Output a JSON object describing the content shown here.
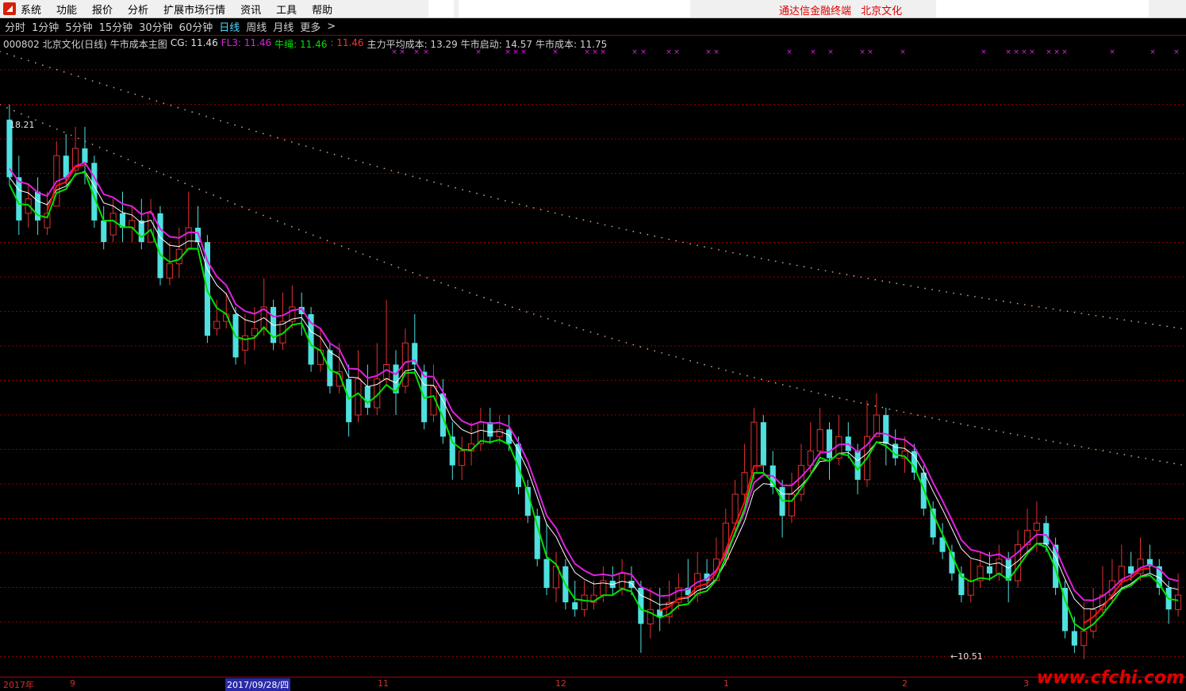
{
  "menu": {
    "items": [
      "系统",
      "功能",
      "报价",
      "分析",
      "扩展市场行情",
      "资讯",
      "工具",
      "帮助"
    ],
    "brand": "通达信金融终端",
    "stock_name": "北京文化"
  },
  "periods": {
    "items": [
      "分时",
      "1分钟",
      "5分钟",
      "15分钟",
      "30分钟",
      "60分钟",
      "日线",
      "周线",
      "月线",
      "更多"
    ],
    "active": "日线",
    "more_arrow": ">"
  },
  "info": {
    "code_title": "000802 北京文化(日线) 牛市成本主图",
    "cg": "CG: 11.46",
    "fl3": "FL3: 11.46",
    "niusheng": "牛绳: 11.46",
    "unnamed": ": 11.46",
    "main_cost": "主力平均成本: 13.29",
    "bull_start": "牛市启动: 14.57",
    "bull_cost": "牛市成本: 11.75"
  },
  "colors": {
    "up": "#e03030",
    "down": "#4fe0e0",
    "ma_magenta": "#e020e0",
    "ma_white": "#ffffff",
    "ma_green": "#00e000",
    "cost_red": "#ff1010",
    "grid": "#8a0000",
    "dots": "#c0a080",
    "cross": "#e020e0"
  },
  "annotations": {
    "high_label": "18.21",
    "low_label": "←10.51"
  },
  "axis": {
    "labels": [
      "2017年",
      "9",
      "2017/09/28/四",
      "11",
      "12",
      "1",
      "2",
      "3"
    ],
    "selected": "2017/09/28/四"
  },
  "watermark": "www.cfchi.com",
  "chart_data": {
    "type": "candlestick",
    "title": "000802 北京文化(日线) 牛市成本主图",
    "ylim": [
      10.3,
      19.0
    ],
    "high": 18.21,
    "low": 10.51,
    "candles_n": 125,
    "candles": [
      [
        18.0,
        17.2,
        18.21,
        17.1
      ],
      [
        17.2,
        16.6,
        17.5,
        16.4
      ],
      [
        16.7,
        16.9,
        17.1,
        16.5
      ],
      [
        17.0,
        16.6,
        17.2,
        16.4
      ],
      [
        16.5,
        16.7,
        17.0,
        16.4
      ],
      [
        16.8,
        17.5,
        17.7,
        16.8
      ],
      [
        17.5,
        17.2,
        17.8,
        17.1
      ],
      [
        17.3,
        17.6,
        17.9,
        17.2
      ],
      [
        17.6,
        17.4,
        17.9,
        17.1
      ],
      [
        17.4,
        16.6,
        17.5,
        16.5
      ],
      [
        16.6,
        16.3,
        16.8,
        16.2
      ],
      [
        16.4,
        16.7,
        16.9,
        16.3
      ],
      [
        16.7,
        16.5,
        17.0,
        16.3
      ],
      [
        16.5,
        16.6,
        16.8,
        16.3
      ],
      [
        16.6,
        16.3,
        16.9,
        16.2
      ],
      [
        16.3,
        16.7,
        16.9,
        16.3
      ],
      [
        16.7,
        15.8,
        16.8,
        15.7
      ],
      [
        15.8,
        16.0,
        16.3,
        15.7
      ],
      [
        16.0,
        16.2,
        16.5,
        15.8
      ],
      [
        16.2,
        16.5,
        17.0,
        16.2
      ],
      [
        16.5,
        16.3,
        16.8,
        16.2
      ],
      [
        16.3,
        15.0,
        16.4,
        14.9
      ],
      [
        15.1,
        15.2,
        15.5,
        15.0
      ],
      [
        15.2,
        15.3,
        15.6,
        15.1
      ],
      [
        15.3,
        14.7,
        15.4,
        14.6
      ],
      [
        14.8,
        15.0,
        15.3,
        14.6
      ],
      [
        15.0,
        15.1,
        15.4,
        14.8
      ],
      [
        15.1,
        15.4,
        15.8,
        15.0
      ],
      [
        15.4,
        14.9,
        15.5,
        14.8
      ],
      [
        14.9,
        15.2,
        15.6,
        14.8
      ],
      [
        15.2,
        15.4,
        15.7,
        15.1
      ],
      [
        15.4,
        15.3,
        15.6,
        15.0
      ],
      [
        15.3,
        14.6,
        15.4,
        14.5
      ],
      [
        14.6,
        14.8,
        15.1,
        14.5
      ],
      [
        14.8,
        14.3,
        14.9,
        14.2
      ],
      [
        14.3,
        14.5,
        14.9,
        14.2
      ],
      [
        14.4,
        13.8,
        14.6,
        13.6
      ],
      [
        13.9,
        14.4,
        14.8,
        13.8
      ],
      [
        14.3,
        14.0,
        14.6,
        13.9
      ],
      [
        14.0,
        14.4,
        14.9,
        13.9
      ],
      [
        14.4,
        14.6,
        15.5,
        14.3
      ],
      [
        14.6,
        14.2,
        14.8,
        13.9
      ],
      [
        14.3,
        14.9,
        15.1,
        14.2
      ],
      [
        14.9,
        14.6,
        15.3,
        14.5
      ],
      [
        14.5,
        13.8,
        14.6,
        13.7
      ],
      [
        13.9,
        14.3,
        14.6,
        13.8
      ],
      [
        14.2,
        13.6,
        14.4,
        13.5
      ],
      [
        13.6,
        13.2,
        13.8,
        13.0
      ],
      [
        13.2,
        13.4,
        13.6,
        13.0
      ],
      [
        13.4,
        13.5,
        13.8,
        13.2
      ],
      [
        13.5,
        13.8,
        14.0,
        13.4
      ],
      [
        13.8,
        13.6,
        14.0,
        13.5
      ],
      [
        13.6,
        13.7,
        13.9,
        13.5
      ],
      [
        13.7,
        13.5,
        13.9,
        13.4
      ],
      [
        13.5,
        12.9,
        13.6,
        12.8
      ],
      [
        12.9,
        12.5,
        13.0,
        12.4
      ],
      [
        12.5,
        11.9,
        12.6,
        11.8
      ],
      [
        11.9,
        11.5,
        12.4,
        11.4
      ],
      [
        11.5,
        11.8,
        12.0,
        11.3
      ],
      [
        11.8,
        11.3,
        11.9,
        11.2
      ],
      [
        11.3,
        11.2,
        11.6,
        11.1
      ],
      [
        11.2,
        11.4,
        11.6,
        11.1
      ],
      [
        11.3,
        11.4,
        11.6,
        11.2
      ],
      [
        11.4,
        11.6,
        11.8,
        11.3
      ],
      [
        11.6,
        11.5,
        11.8,
        11.4
      ],
      [
        11.5,
        11.7,
        11.9,
        11.4
      ],
      [
        11.6,
        11.5,
        11.8,
        11.4
      ],
      [
        11.5,
        11.0,
        11.6,
        10.6
      ],
      [
        11.0,
        11.2,
        11.5,
        10.8
      ],
      [
        11.2,
        11.1,
        11.5,
        10.9
      ],
      [
        11.1,
        11.3,
        11.6,
        11.0
      ],
      [
        11.3,
        11.5,
        11.7,
        11.2
      ],
      [
        11.5,
        11.4,
        11.9,
        11.3
      ],
      [
        11.4,
        11.7,
        12.0,
        11.3
      ],
      [
        11.7,
        11.6,
        11.9,
        11.5
      ],
      [
        11.6,
        11.9,
        12.2,
        11.6
      ],
      [
        11.9,
        12.4,
        12.6,
        11.8
      ],
      [
        12.4,
        12.8,
        13.0,
        12.2
      ],
      [
        12.8,
        13.1,
        13.5,
        12.7
      ],
      [
        13.1,
        13.8,
        14.0,
        13.0
      ],
      [
        13.8,
        13.2,
        13.9,
        13.1
      ],
      [
        13.2,
        12.9,
        13.4,
        12.8
      ],
      [
        12.9,
        12.5,
        13.0,
        12.2
      ],
      [
        12.5,
        12.8,
        13.1,
        12.4
      ],
      [
        12.8,
        13.2,
        13.5,
        12.7
      ],
      [
        13.2,
        13.4,
        13.8,
        13.1
      ],
      [
        13.4,
        13.7,
        14.0,
        13.3
      ],
      [
        13.7,
        13.3,
        13.8,
        13.0
      ],
      [
        13.3,
        13.6,
        13.9,
        13.2
      ],
      [
        13.6,
        13.4,
        13.8,
        13.3
      ],
      [
        13.4,
        13.0,
        13.5,
        12.8
      ],
      [
        13.0,
        13.6,
        14.1,
        12.9
      ],
      [
        13.6,
        13.9,
        14.2,
        13.6
      ],
      [
        13.9,
        13.5,
        14.0,
        13.2
      ],
      [
        13.5,
        13.3,
        13.7,
        13.2
      ],
      [
        13.3,
        13.4,
        13.6,
        13.1
      ],
      [
        13.4,
        13.1,
        13.5,
        13.0
      ],
      [
        13.1,
        12.6,
        13.2,
        12.5
      ],
      [
        12.6,
        12.2,
        12.7,
        12.1
      ],
      [
        12.2,
        12.0,
        12.4,
        11.9
      ],
      [
        12.0,
        11.7,
        12.1,
        11.6
      ],
      [
        11.7,
        11.4,
        11.8,
        11.3
      ],
      [
        11.4,
        11.6,
        11.9,
        11.3
      ],
      [
        11.6,
        11.8,
        12.0,
        11.5
      ],
      [
        11.8,
        11.7,
        12.0,
        11.6
      ],
      [
        11.7,
        11.9,
        12.1,
        11.6
      ],
      [
        11.9,
        11.6,
        12.0,
        11.3
      ],
      [
        11.6,
        12.1,
        12.3,
        11.5
      ],
      [
        12.1,
        12.3,
        12.6,
        12.0
      ],
      [
        12.3,
        12.4,
        12.7,
        12.0
      ],
      [
        12.4,
        12.1,
        12.5,
        12.0
      ],
      [
        12.1,
        11.5,
        12.2,
        11.4
      ],
      [
        11.5,
        10.9,
        11.6,
        10.8
      ],
      [
        10.9,
        10.7,
        11.1,
        10.6
      ],
      [
        10.7,
        10.9,
        11.3,
        10.51
      ],
      [
        10.9,
        11.2,
        11.5,
        10.8
      ],
      [
        11.2,
        11.4,
        11.8,
        11.1
      ],
      [
        11.4,
        11.6,
        11.9,
        11.3
      ],
      [
        11.6,
        11.8,
        12.1,
        11.5
      ],
      [
        11.8,
        11.7,
        12.0,
        11.6
      ],
      [
        11.7,
        11.9,
        12.2,
        11.6
      ],
      [
        11.9,
        11.8,
        12.1,
        11.7
      ],
      [
        11.8,
        11.5,
        11.9,
        11.4
      ],
      [
        11.5,
        11.2,
        11.6,
        11.0
      ],
      [
        11.2,
        11.4,
        11.7,
        11.1
      ]
    ]
  }
}
